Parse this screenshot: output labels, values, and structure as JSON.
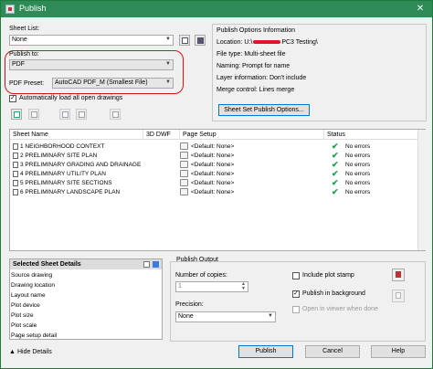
{
  "window": {
    "title": "Publish",
    "close_glyph": "✕"
  },
  "sheet_list": {
    "label": "Sheet List:",
    "value": "None"
  },
  "publish_to": {
    "label": "Publish to:",
    "value": "PDF"
  },
  "pdf_preset": {
    "label": "PDF Preset:",
    "value": "AutoCAD PDF_M (Smallest File)"
  },
  "auto_load": {
    "label": "Automatically load all open drawings",
    "checked": true
  },
  "publish_options": {
    "title": "Publish Options Information",
    "location": "Location: U:\\",
    "location_tail": "PC3 Testing\\",
    "file_type": "File type: Multi-sheet file",
    "naming": "Naming: Prompt for name",
    "layer_info": "Layer information: Don't include",
    "merge_control": "Merge control: Lines merge",
    "button": "Sheet Set Publish Options..."
  },
  "sheets_table": {
    "columns": [
      "Sheet Name",
      "3D DWF",
      "Page Setup",
      "Status"
    ],
    "rows": [
      {
        "name": "1 NEIGHBORHOOD CONTEXT",
        "setup": "<Default: None>",
        "status": "No errors"
      },
      {
        "name": "2 PRELIMINARY SITE PLAN",
        "setup": "<Default: None>",
        "status": "No errors"
      },
      {
        "name": "3 PRELIMINARY GRADING AND DRAINAGE",
        "setup": "<Default: None>",
        "status": "No errors"
      },
      {
        "name": "4 PRELIMINARY UTILITY PLAN",
        "setup": "<Default: None>",
        "status": "No errors"
      },
      {
        "name": "5 PRELIMINARY SITE SECTIONS",
        "setup": "<Default: None>",
        "status": "No errors"
      },
      {
        "name": "6 PRELIMINARY LANDSCAPE PLAN",
        "setup": "<Default: None>",
        "status": "No errors"
      }
    ]
  },
  "selected_details": {
    "title": "Selected Sheet Details",
    "items": [
      "Source drawing",
      "Drawing location",
      "Layout name",
      "Plot device",
      "Plot size",
      "Plot scale",
      "Page setup detail"
    ]
  },
  "publish_output": {
    "title": "Publish Output",
    "copies_label": "Number of copies:",
    "copies_value": "1",
    "precision_label": "Precision:",
    "precision_value": "None",
    "include_stamp": "Include plot stamp",
    "in_background": "Publish in background",
    "open_viewer": "Open in viewer when done"
  },
  "footer": {
    "hide_details": "Hide Details",
    "publish": "Publish",
    "cancel": "Cancel",
    "help": "Help"
  },
  "colors": {
    "titlebar": "#2e8b57",
    "check": "#1aa34a",
    "annotation": "#e01010",
    "redaction": "#e8102a"
  }
}
